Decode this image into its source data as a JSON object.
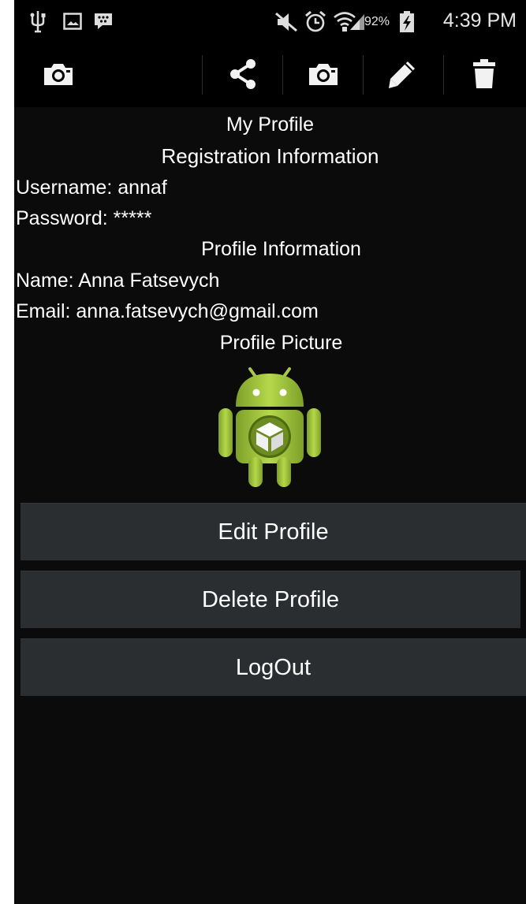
{
  "status_bar": {
    "icons": [
      "usb-icon",
      "picture-icon",
      "bbm-icon",
      "mute-icon",
      "alarm-icon",
      "wifi-icon",
      "signal-icon",
      "battery-charging-icon"
    ],
    "battery": "92%",
    "time": "4:39 PM"
  },
  "action_bar": {
    "icons": [
      "camera-icon",
      "share-icon",
      "camera-icon",
      "pencil-icon",
      "trash-icon"
    ]
  },
  "profile": {
    "title": "My Profile",
    "registration_heading": "Registration Information",
    "username_line": "Username: annaf",
    "password_line": "Password: *****",
    "profile_heading": "Profile Information",
    "name_line": "Name:  Anna Fatsevych",
    "email_line": "Email: anna.fatsevych@gmail.com",
    "picture_heading": "Profile Picture",
    "picture_icon": "android-robot-icon"
  },
  "buttons": {
    "edit": "Edit Profile",
    "delete": "Delete Profile",
    "logout": "LogOut"
  },
  "colors": {
    "background": "#0b0b0b",
    "button": "#2a2e31",
    "android_green": "#9fc33a"
  }
}
